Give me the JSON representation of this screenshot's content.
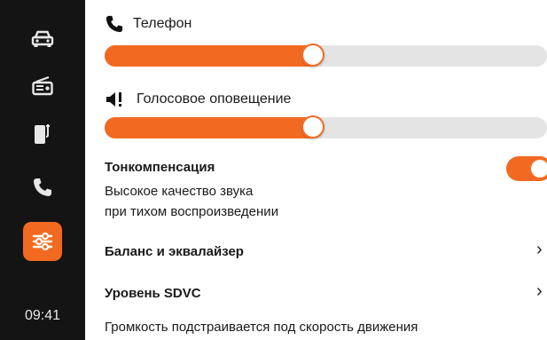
{
  "sidebar": {
    "items": [
      {
        "icon": "car-icon"
      },
      {
        "icon": "radio-icon"
      },
      {
        "icon": "phone-device-icon"
      },
      {
        "icon": "phone-icon"
      },
      {
        "icon": "equalizer-settings-icon",
        "active": true
      }
    ],
    "time": "09:41"
  },
  "phone": {
    "label": "Телефон",
    "icon": "phone-icon",
    "level": 0.47
  },
  "voice": {
    "label": "Голосовое оповещение",
    "icon": "speaker-alert-icon",
    "level": 0.47
  },
  "tonecomp": {
    "title": "Тонкомпенсация",
    "desc_line1": "Высокое качество звука",
    "desc_line2": "при тихом воспроизведении",
    "enabled": true
  },
  "balance": {
    "title": "Баланс и эквалайзер",
    "chevron": "›"
  },
  "sdvc": {
    "title": "Уровень SDVC",
    "chevron": "›",
    "desc": "Громкость подстраивается под скорость движения"
  },
  "colors": {
    "accent": "#f26a21",
    "sidebar_bg": "#141414",
    "track": "#e4e4e4"
  }
}
